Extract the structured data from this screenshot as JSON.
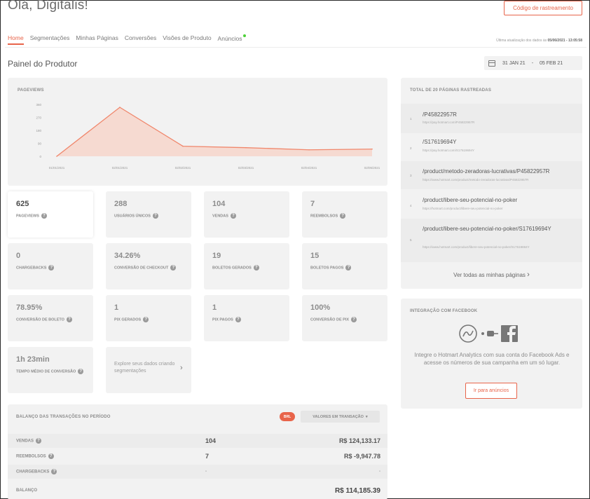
{
  "header": {
    "greeting": "Olá, Digitalis!",
    "tracking_button": "Código de rastreamento",
    "last_update_label": "Última atualização dos dados às",
    "last_update_value": "05/06/2021 - 13:05:58"
  },
  "nav": {
    "tabs": [
      {
        "label": "Home",
        "active": true
      },
      {
        "label": "Segmentações",
        "active": false
      },
      {
        "label": "Minhas Páginas",
        "active": false
      },
      {
        "label": "Conversões",
        "active": false
      },
      {
        "label": "Visões de Produto",
        "active": false
      },
      {
        "label": "Anúncios",
        "active": false,
        "badge": "new-dot"
      }
    ]
  },
  "panel": {
    "title": "Painel do Produtor",
    "date_start": "31 JAN 21",
    "date_sep": "-",
    "date_end": "05 FEB 21"
  },
  "pageviews_chart": {
    "title": "PAGEVIEWS",
    "chart_data": {
      "type": "area",
      "title": "PAGEVIEWS",
      "x": [
        "01/01/2021",
        "02/01/2021",
        "02/02/2021",
        "02/03/2021",
        "02/04/2021",
        "02/05/2021"
      ],
      "series": [
        {
          "values": [
            0,
            340,
            70,
            60,
            45,
            50
          ]
        }
      ],
      "yticks": [
        "360",
        "270",
        "180",
        "90",
        "0"
      ],
      "ylim": [
        0,
        360
      ],
      "grid": false,
      "color": "#f0876c"
    }
  },
  "metrics": [
    {
      "value": "625",
      "label": "PAGEVIEWS",
      "highlight": true
    },
    {
      "value": "288",
      "label": "USUÁRIOS ÚNICOS"
    },
    {
      "value": "104",
      "label": "VENDAS"
    },
    {
      "value": "7",
      "label": "REEMBOLSOS"
    },
    {
      "value": "0",
      "label": "CHARGEBACKS"
    },
    {
      "value": "34.26%",
      "label": "CONVERSÃO DE CHECKOUT"
    },
    {
      "value": "19",
      "label": "BOLETOS GERADOS"
    },
    {
      "value": "15",
      "label": "BOLETOS PAGOS"
    },
    {
      "value": "78.95%",
      "label": "CONVERSÃO DE BOLETO"
    },
    {
      "value": "1",
      "label": "PIX GERADOS"
    },
    {
      "value": "1",
      "label": "PIX PAGOS"
    },
    {
      "value": "100%",
      "label": "CONVERSÃO DE PIX"
    },
    {
      "value": "1h 23min",
      "label": "TEMPO MÉDIO DE CONVERSÃO"
    }
  ],
  "explore": {
    "text": "Explore seus dados criando segmentações"
  },
  "balance": {
    "title": "BALANÇO DAS TRANSAÇÕES NO PERÍODO",
    "currency_badge": "BRL",
    "dropdown_label": "VALORES EM TRANSAÇÃO",
    "rows": [
      {
        "label": "VENDAS",
        "count": "104",
        "amount": "R$ 124,133.17"
      },
      {
        "label": "REEMBOLSOS",
        "count": "7",
        "amount": "R$ -9,947.78"
      },
      {
        "label": "CHARGEBACKS",
        "count": "-",
        "amount": "-"
      },
      {
        "label": "BALANÇO",
        "count": "",
        "amount": "R$ 114,185.39"
      }
    ]
  },
  "pages": {
    "title": "TOTAL DE 20 PÁGINAS RASTREADAS",
    "items": [
      {
        "num": "1",
        "path": "/P45822957R",
        "url": "https://pay.hotmart.com/P45822957R"
      },
      {
        "num": "2",
        "path": "/S17619694Y",
        "url": "https://pay.hotmart.com/S17619694Y"
      },
      {
        "num": "3",
        "path": "/product/metodo-zeradoras-lucrativas/P45822957R",
        "url": "https://www.hotmart.com/product/metodo-zeradoras-lucrativas/P45822957R"
      },
      {
        "num": "4",
        "path": "/product/libere-seu-potencial-no-poker",
        "url": "https://hotmart.com/product/libere-seu-potencial-no-poker"
      },
      {
        "num": "5",
        "path": "/product/libere-seu-potencial-no-poker/S17619694Y",
        "url": "https://www.hotmart.com/product/libere-seu-potencial-no-poker/S17619694Y"
      }
    ],
    "see_all": "Ver todas as minhas páginas"
  },
  "facebook": {
    "title": "INTEGRAÇÃO COM FACEBOOK",
    "text": "Integre o Hotmart Analytics com sua conta do Facebook Ads e acesse os números de sua campanha em um só lugar.",
    "button": "Ir para anúncios"
  }
}
